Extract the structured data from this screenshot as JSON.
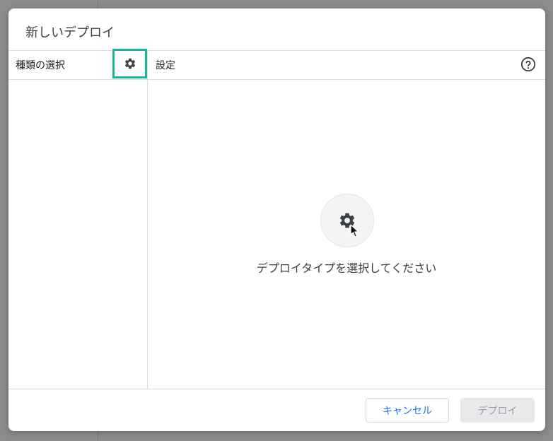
{
  "dialog": {
    "title": "新しいデプロイ",
    "left_pane": {
      "label": "種類の選択",
      "settings_icon": "gear-icon"
    },
    "right_pane": {
      "label": "設定",
      "help_icon": "help-circle-icon"
    },
    "empty_state": {
      "icon": "gear-icon",
      "message": "デプロイタイプを選択してください"
    },
    "footer": {
      "cancel_label": "キャンセル",
      "deploy_label": "デプロイ"
    }
  },
  "colors": {
    "highlight": "#17b797",
    "link_blue": "#1a73e8",
    "disabled_text": "#9aa0a6"
  }
}
